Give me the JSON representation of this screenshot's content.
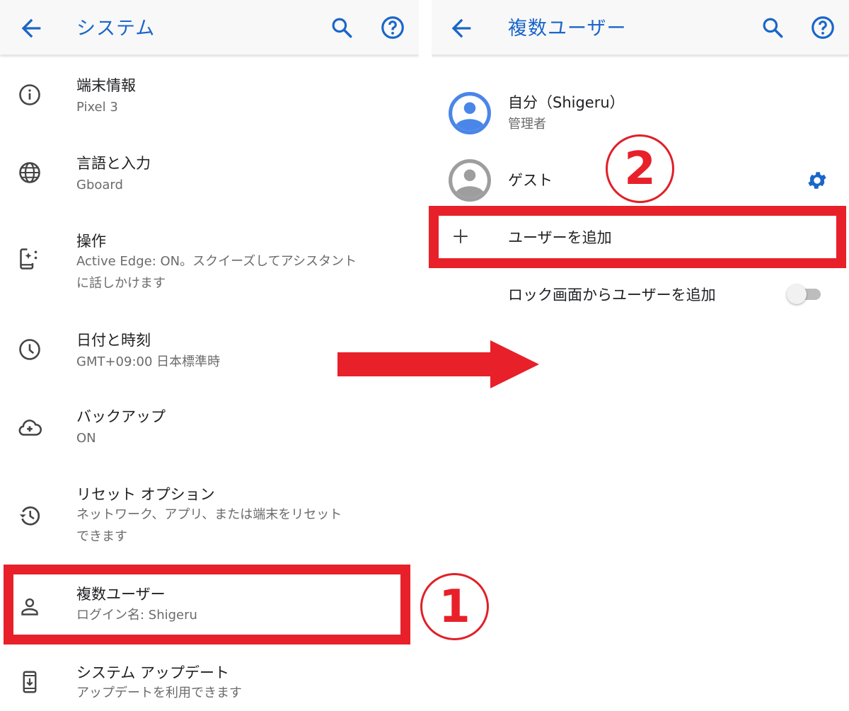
{
  "left_screen": {
    "appbar": {
      "title": "システム",
      "back_icon": "arrow-left-icon",
      "search_icon": "search-icon",
      "help_icon": "help-circle-icon"
    },
    "items": [
      {
        "icon": "info-icon",
        "title": "端末情報",
        "subtitle": "Pixel 3"
      },
      {
        "icon": "globe-icon",
        "title": "言語と入力",
        "subtitle": "Gboard"
      },
      {
        "icon": "gesture-phone-icon",
        "title": "操作",
        "subtitle": "Active Edge: ON。スクイーズしてアシスタント\nに話しかけます"
      },
      {
        "icon": "clock-icon",
        "title": "日付と時刻",
        "subtitle": "GMT+09:00 日本標準時"
      },
      {
        "icon": "cloud-backup-icon",
        "title": "バックアップ",
        "subtitle": "ON"
      },
      {
        "icon": "history-icon",
        "title": "リセット オプション",
        "subtitle": "ネットワーク、アプリ、または端末をリセット\nできます"
      },
      {
        "icon": "person-icon",
        "title": "複数ユーザー",
        "subtitle": "ログイン名: Shigeru"
      },
      {
        "icon": "system-update-icon",
        "title": "システム アップデート",
        "subtitle": "アップデートを利用できます"
      }
    ]
  },
  "right_screen": {
    "appbar": {
      "title": "複数ユーザー",
      "back_icon": "arrow-left-icon",
      "search_icon": "search-icon",
      "help_icon": "help-circle-icon"
    },
    "users": [
      {
        "name": "自分（Shigeru）",
        "role": "管理者",
        "avatar_color": "#4a86e8"
      },
      {
        "name": "ゲスト",
        "role": "",
        "avatar_color": "#9e9e9e",
        "settings_icon": "gear-icon"
      }
    ],
    "add_user_label": "ユーザーを追加",
    "lockscreen_add_label": "ロック画面からユーザーを追加",
    "lockscreen_add_enabled": false
  },
  "annotations": {
    "step1_label": "1",
    "step2_label": "2",
    "highlight_color": "#e8202a",
    "accent_color": "#1a66c9"
  }
}
